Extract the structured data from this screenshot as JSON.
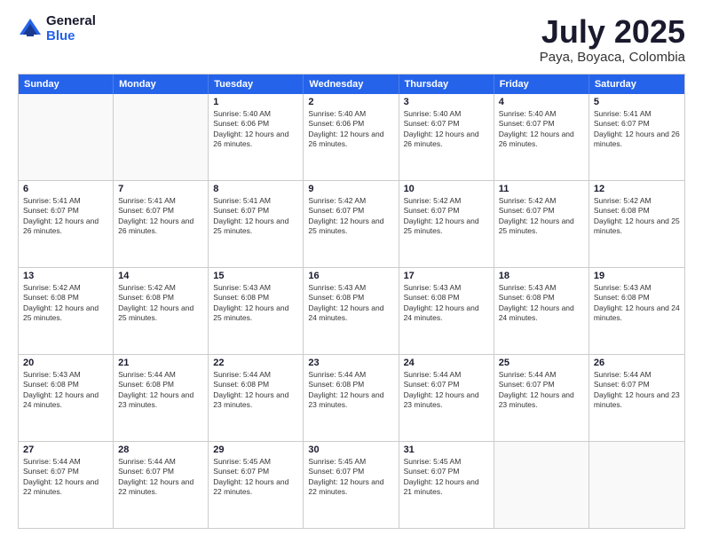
{
  "logo": {
    "general": "General",
    "blue": "Blue"
  },
  "header": {
    "month": "July 2025",
    "location": "Paya, Boyaca, Colombia"
  },
  "weekdays": [
    "Sunday",
    "Monday",
    "Tuesday",
    "Wednesday",
    "Thursday",
    "Friday",
    "Saturday"
  ],
  "rows": [
    [
      {
        "day": "",
        "info": ""
      },
      {
        "day": "",
        "info": ""
      },
      {
        "day": "1",
        "info": "Sunrise: 5:40 AM\nSunset: 6:06 PM\nDaylight: 12 hours and 26 minutes."
      },
      {
        "day": "2",
        "info": "Sunrise: 5:40 AM\nSunset: 6:06 PM\nDaylight: 12 hours and 26 minutes."
      },
      {
        "day": "3",
        "info": "Sunrise: 5:40 AM\nSunset: 6:07 PM\nDaylight: 12 hours and 26 minutes."
      },
      {
        "day": "4",
        "info": "Sunrise: 5:40 AM\nSunset: 6:07 PM\nDaylight: 12 hours and 26 minutes."
      },
      {
        "day": "5",
        "info": "Sunrise: 5:41 AM\nSunset: 6:07 PM\nDaylight: 12 hours and 26 minutes."
      }
    ],
    [
      {
        "day": "6",
        "info": "Sunrise: 5:41 AM\nSunset: 6:07 PM\nDaylight: 12 hours and 26 minutes."
      },
      {
        "day": "7",
        "info": "Sunrise: 5:41 AM\nSunset: 6:07 PM\nDaylight: 12 hours and 26 minutes."
      },
      {
        "day": "8",
        "info": "Sunrise: 5:41 AM\nSunset: 6:07 PM\nDaylight: 12 hours and 25 minutes."
      },
      {
        "day": "9",
        "info": "Sunrise: 5:42 AM\nSunset: 6:07 PM\nDaylight: 12 hours and 25 minutes."
      },
      {
        "day": "10",
        "info": "Sunrise: 5:42 AM\nSunset: 6:07 PM\nDaylight: 12 hours and 25 minutes."
      },
      {
        "day": "11",
        "info": "Sunrise: 5:42 AM\nSunset: 6:07 PM\nDaylight: 12 hours and 25 minutes."
      },
      {
        "day": "12",
        "info": "Sunrise: 5:42 AM\nSunset: 6:08 PM\nDaylight: 12 hours and 25 minutes."
      }
    ],
    [
      {
        "day": "13",
        "info": "Sunrise: 5:42 AM\nSunset: 6:08 PM\nDaylight: 12 hours and 25 minutes."
      },
      {
        "day": "14",
        "info": "Sunrise: 5:42 AM\nSunset: 6:08 PM\nDaylight: 12 hours and 25 minutes."
      },
      {
        "day": "15",
        "info": "Sunrise: 5:43 AM\nSunset: 6:08 PM\nDaylight: 12 hours and 25 minutes."
      },
      {
        "day": "16",
        "info": "Sunrise: 5:43 AM\nSunset: 6:08 PM\nDaylight: 12 hours and 24 minutes."
      },
      {
        "day": "17",
        "info": "Sunrise: 5:43 AM\nSunset: 6:08 PM\nDaylight: 12 hours and 24 minutes."
      },
      {
        "day": "18",
        "info": "Sunrise: 5:43 AM\nSunset: 6:08 PM\nDaylight: 12 hours and 24 minutes."
      },
      {
        "day": "19",
        "info": "Sunrise: 5:43 AM\nSunset: 6:08 PM\nDaylight: 12 hours and 24 minutes."
      }
    ],
    [
      {
        "day": "20",
        "info": "Sunrise: 5:43 AM\nSunset: 6:08 PM\nDaylight: 12 hours and 24 minutes."
      },
      {
        "day": "21",
        "info": "Sunrise: 5:44 AM\nSunset: 6:08 PM\nDaylight: 12 hours and 23 minutes."
      },
      {
        "day": "22",
        "info": "Sunrise: 5:44 AM\nSunset: 6:08 PM\nDaylight: 12 hours and 23 minutes."
      },
      {
        "day": "23",
        "info": "Sunrise: 5:44 AM\nSunset: 6:08 PM\nDaylight: 12 hours and 23 minutes."
      },
      {
        "day": "24",
        "info": "Sunrise: 5:44 AM\nSunset: 6:07 PM\nDaylight: 12 hours and 23 minutes."
      },
      {
        "day": "25",
        "info": "Sunrise: 5:44 AM\nSunset: 6:07 PM\nDaylight: 12 hours and 23 minutes."
      },
      {
        "day": "26",
        "info": "Sunrise: 5:44 AM\nSunset: 6:07 PM\nDaylight: 12 hours and 23 minutes."
      }
    ],
    [
      {
        "day": "27",
        "info": "Sunrise: 5:44 AM\nSunset: 6:07 PM\nDaylight: 12 hours and 22 minutes."
      },
      {
        "day": "28",
        "info": "Sunrise: 5:44 AM\nSunset: 6:07 PM\nDaylight: 12 hours and 22 minutes."
      },
      {
        "day": "29",
        "info": "Sunrise: 5:45 AM\nSunset: 6:07 PM\nDaylight: 12 hours and 22 minutes."
      },
      {
        "day": "30",
        "info": "Sunrise: 5:45 AM\nSunset: 6:07 PM\nDaylight: 12 hours and 22 minutes."
      },
      {
        "day": "31",
        "info": "Sunrise: 5:45 AM\nSunset: 6:07 PM\nDaylight: 12 hours and 21 minutes."
      },
      {
        "day": "",
        "info": ""
      },
      {
        "day": "",
        "info": ""
      }
    ]
  ]
}
